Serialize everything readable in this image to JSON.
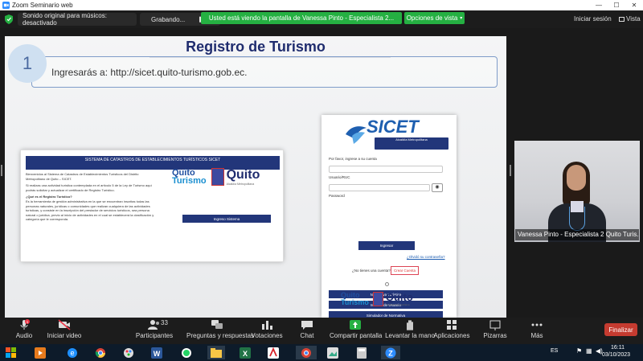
{
  "window": {
    "title": "Zoom Seminario web",
    "controls": [
      "—",
      "☐",
      "✕"
    ]
  },
  "zoombar": {
    "sound_chip": "Sonido original para músicos: desactivado",
    "recording_label": "Grabando...",
    "banner_text": "Usted está viendo la pantalla de Vanessa Pinto - Especialista 2...",
    "view_options": "Opciones de vista",
    "login": "Iniciar sesión",
    "view": "Vista"
  },
  "slide": {
    "title": "Registro de Turismo",
    "step_number": "1",
    "step_text": "Ingresarás a: http://sicet.quito-turismo.gob.ec.",
    "site1": {
      "header": "SISTEMA DE CATASTROS DE ESTABLECIMIENTOS TURÍSTICOS SICET",
      "p1": "Bienvenidos al Sistema de Catastros de Establecimientos Turísticos del Distrito Metropolitano de Quito – SICET.",
      "p2": "Si realizas una actividad turística contemplada en el artículo 5 de la Ley de Turismo aquí podrás solicitar y actualizar el certificado de Registro Turístico.",
      "p3_title": "¿Qué es el Registro Turístico?",
      "p3": "Es la herramienta de gestión administrativa en la que se encuentran inscritas todas las personas naturales, jurídicas o comunidades que realizan cualquiera de las actividades turísticas, y consiste en la inscripción del prestador de servicios turísticos, sea persona natural o jurídica, previo al inicio de actividades en el cual se establecerá la clasificación y categoría que le corresponda.",
      "logo_quito": "Quito",
      "logo_turismo": "Turismo",
      "logo_word": "Quito",
      "logo_sub": "Alcaldía Metropolitana",
      "button": "Ingreso Sistema"
    },
    "site2": {
      "logo": "SICET",
      "logo_sub": "Alcaldía Metropolitana",
      "prompt": "Por favor, ingrese a su cuenta",
      "user_label": "Usuario/RUC",
      "password_label": "Password",
      "login_button": "Ingresar",
      "forgot": "¿Olvidó su contraseña?",
      "no_account": "¿No tienes una cuenta?",
      "create": "Crear Cuenta",
      "nav": [
        "Normativa Turística",
        "Manual de Usuario",
        "Simulador de Normativa"
      ],
      "logo_quito": "Quito",
      "logo_turismo": "Turismo",
      "logo_word": "Quito"
    }
  },
  "participant": {
    "name": "Vanessa Pinto - Especialista 2 Quito Turis..."
  },
  "toolbar": {
    "audio": "Audio",
    "video": "Iniciar video",
    "participants": "Participantes",
    "participants_count": "33",
    "qa": "Preguntas y respuestas",
    "polls": "Votaciones",
    "chat": "Chat",
    "share": "Compartir pantalla",
    "raise_hand": "Levantar la mano",
    "apps": "Aplicaciones",
    "whiteboards": "Pizarras",
    "more": "Más",
    "end": "Finalizar",
    "audio_badge": "1"
  },
  "taskbar": {
    "language": "ES",
    "time": "16:11",
    "date": "03/10/2023"
  }
}
